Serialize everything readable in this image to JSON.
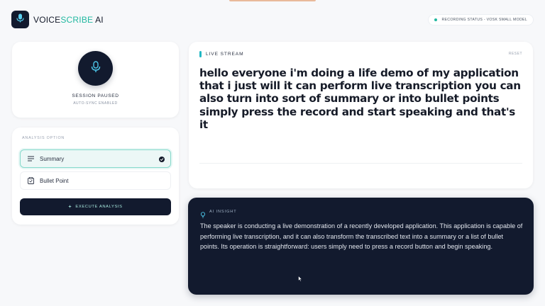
{
  "header": {
    "logo_word1": "VOICE",
    "logo_word2": "SCRIBE",
    "logo_word3": " AI",
    "status": "RECORDING STATUS - VOSK SMALL MODEL"
  },
  "session": {
    "status": "SESSION PAUSED",
    "sub": "AUTO-SYNC ENABLED"
  },
  "analysis": {
    "section_label": "ANALYSIS OPTION",
    "options": [
      {
        "label": "Summary",
        "selected": true
      },
      {
        "label": "Bullet Point",
        "selected": false
      }
    ],
    "execute_label": "EXECUTE ANALYSIS"
  },
  "stream": {
    "label": "LIVE STREAM",
    "reset_label": "RESET",
    "transcript": "hello everyone i'm doing a life demo of my application that i just will it can perform live transcription you can also turn into sort of summary or into bullet points simply press the record and start speaking and that's it"
  },
  "insight": {
    "label": "AI INSIGHT",
    "text": "The speaker is conducting a live demonstration of a recently developed application. This application is capable of performing live transcription, and it can also transform the transcribed text into a summary or a list of bullet points. Its operation is straightforward: users simply need to press a record button and begin speaking."
  },
  "colors": {
    "accent": "#22b8a0",
    "dark": "#121a2e",
    "background": "#f7f8fa"
  },
  "icons": {
    "logo": "microphone-icon",
    "record": "microphone-icon",
    "summary": "list-icon",
    "bullet": "clipboard-icon",
    "selected": "check-circle-icon",
    "execute": "sparkle-icon",
    "insight": "lightbulb-icon"
  }
}
